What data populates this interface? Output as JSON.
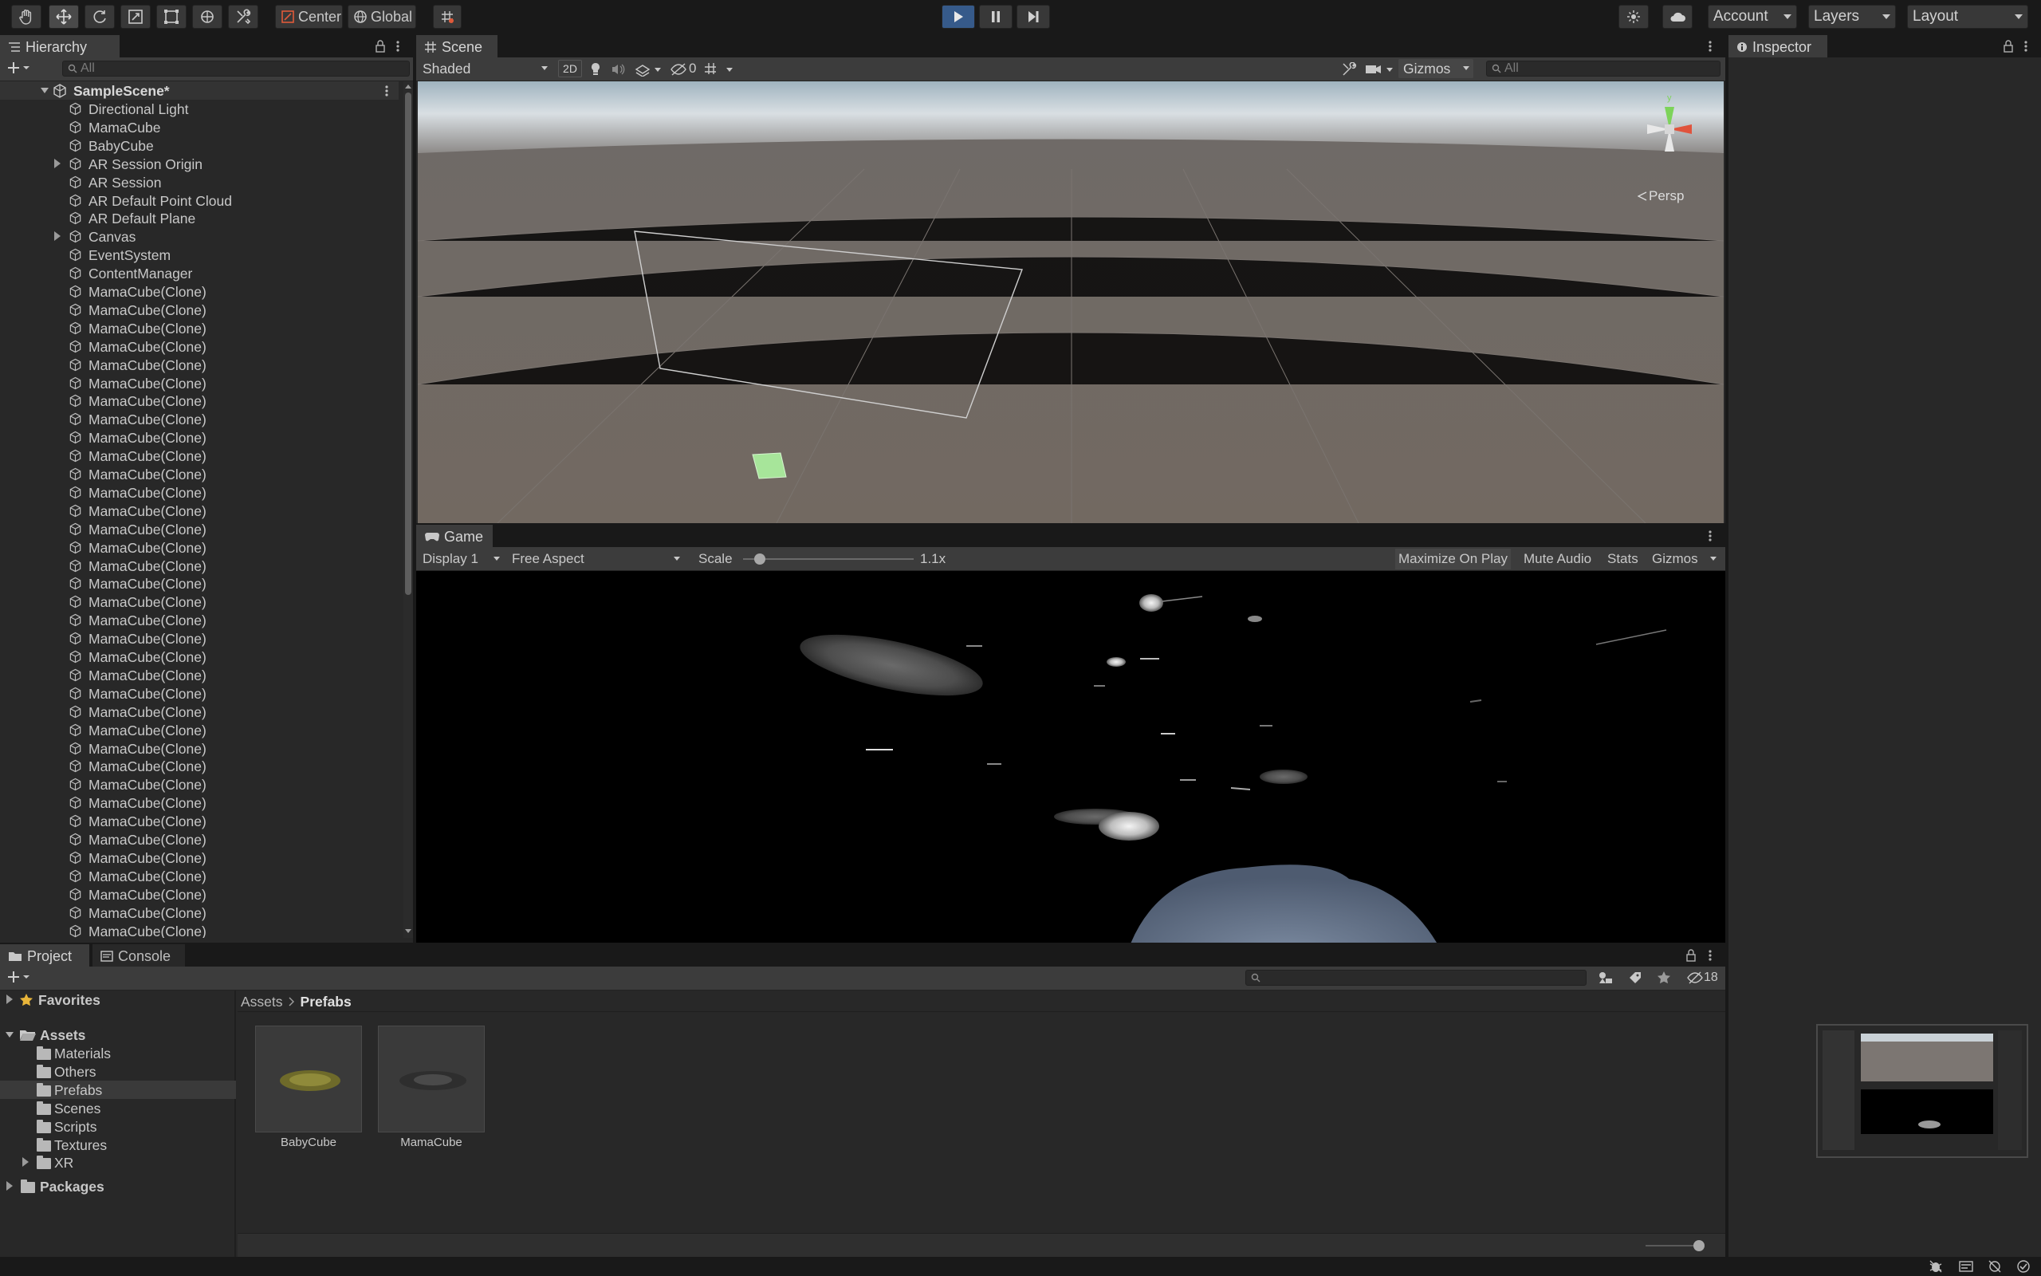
{
  "toolbar": {
    "pivot_center": "Center",
    "pivot_global": "Global",
    "account": "Account",
    "layers": "Layers",
    "layout": "Layout"
  },
  "hierarchy": {
    "tab": "Hierarchy",
    "search_placeholder": "All",
    "scene": "SampleScene*",
    "items": [
      "Directional Light",
      "MamaCube",
      "BabyCube",
      "AR Session Origin",
      "AR Session",
      "AR Default Point Cloud",
      "AR Default Plane",
      "Canvas",
      "EventSystem",
      "ContentManager",
      "MamaCube(Clone)",
      "MamaCube(Clone)",
      "MamaCube(Clone)",
      "MamaCube(Clone)",
      "MamaCube(Clone)",
      "MamaCube(Clone)",
      "MamaCube(Clone)",
      "MamaCube(Clone)",
      "MamaCube(Clone)",
      "MamaCube(Clone)",
      "MamaCube(Clone)",
      "MamaCube(Clone)",
      "MamaCube(Clone)",
      "MamaCube(Clone)",
      "MamaCube(Clone)",
      "MamaCube(Clone)",
      "MamaCube(Clone)",
      "MamaCube(Clone)",
      "MamaCube(Clone)",
      "MamaCube(Clone)",
      "MamaCube(Clone)",
      "MamaCube(Clone)",
      "MamaCube(Clone)",
      "MamaCube(Clone)",
      "MamaCube(Clone)",
      "MamaCube(Clone)",
      "MamaCube(Clone)",
      "MamaCube(Clone)",
      "MamaCube(Clone)",
      "MamaCube(Clone)",
      "MamaCube(Clone)",
      "MamaCube(Clone)",
      "MamaCube(Clone)",
      "MamaCube(Clone)",
      "MamaCube(Clone)",
      "MamaCube(Clone)"
    ],
    "foldouts": [
      "AR Session Origin",
      "Canvas"
    ]
  },
  "scene": {
    "tab": "Scene",
    "shading": "Shaded",
    "mode_2d": "2D",
    "hidden_count": "0",
    "gizmos": "Gizmos",
    "search_placeholder": "All",
    "projection": "Persp",
    "axis_y": "y"
  },
  "game": {
    "tab": "Game",
    "display": "Display 1",
    "aspect": "Free Aspect",
    "scale_label": "Scale",
    "scale_value": "1.1x",
    "maximize": "Maximize On Play",
    "mute": "Mute Audio",
    "stats": "Stats",
    "gizmos": "Gizmos"
  },
  "inspector": {
    "tab": "Inspector"
  },
  "project": {
    "tab_project": "Project",
    "tab_console": "Console",
    "hidden_count": "18",
    "favorites": "Favorites",
    "assets": "Assets",
    "folders": [
      "Materials",
      "Others",
      "Prefabs",
      "Scenes",
      "Scripts",
      "Textures",
      "XR"
    ],
    "selected_folder": "Prefabs",
    "packages": "Packages",
    "breadcrumb": [
      "Assets",
      "Prefabs"
    ],
    "prefabs": [
      "BabyCube",
      "MamaCube"
    ]
  },
  "colors": {
    "accent": "#365a8a",
    "selection": "#3a3a3a",
    "panel": "#282828",
    "toolbar": "#191919"
  }
}
